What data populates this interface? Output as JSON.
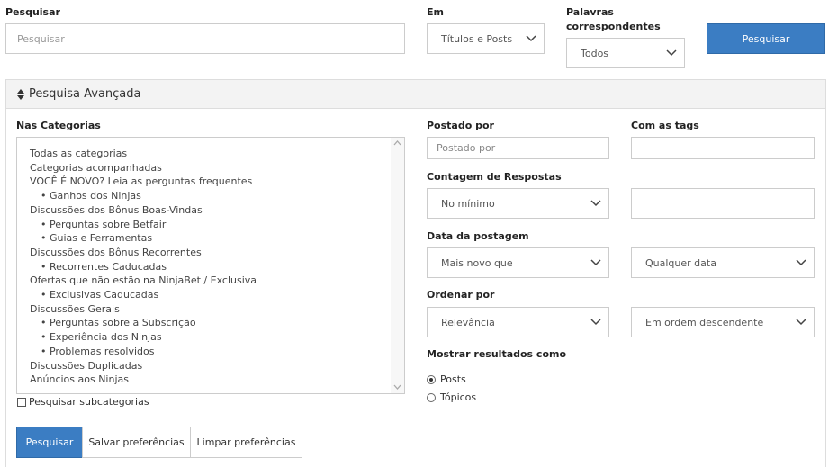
{
  "search": {
    "label": "Pesquisar",
    "placeholder": "Pesquisar",
    "in_label": "Em",
    "in_value": "Títulos e Posts",
    "match_label": "Palavras correspondentes",
    "match_value": "Todos",
    "submit_label": "Pesquisar"
  },
  "advanced": {
    "title": "Pesquisa Avançada",
    "categories_label": "Nas Categorias",
    "categories": [
      {
        "label": "Todas as categorias",
        "level": 0
      },
      {
        "label": "Categorias acompanhadas",
        "level": 0
      },
      {
        "label": "VOCÊ É NOVO? Leia as perguntas frequentes",
        "level": 0
      },
      {
        "label": "• Ganhos dos Ninjas",
        "level": 1
      },
      {
        "label": "Discussões dos Bônus Boas-Vindas",
        "level": 0
      },
      {
        "label": "• Perguntas sobre Betfair",
        "level": 1
      },
      {
        "label": "• Guias e Ferramentas",
        "level": 1
      },
      {
        "label": "Discussões dos Bônus Recorrentes",
        "level": 0
      },
      {
        "label": "• Recorrentes Caducadas",
        "level": 1
      },
      {
        "label": "Ofertas que não estão na NinjaBet / Exclusiva",
        "level": 0
      },
      {
        "label": "• Exclusivas Caducadas",
        "level": 1
      },
      {
        "label": "Discussões Gerais",
        "level": 0
      },
      {
        "label": "• Perguntas sobre a Subscrição",
        "level": 1
      },
      {
        "label": "• Experiência dos Ninjas",
        "level": 1
      },
      {
        "label": "• Problemas resolvidos",
        "level": 1
      },
      {
        "label": "Discussões Duplicadas",
        "level": 0
      },
      {
        "label": "Anúncios aos Ninjas",
        "level": 0
      }
    ],
    "subcategories_label": "Pesquisar subcategorias",
    "posted_by_label": "Postado por",
    "posted_by_placeholder": "Postado por",
    "tags_label": "Com as tags",
    "reply_count_label": "Contagem de Respostas",
    "reply_count_value": "No mínimo",
    "post_date_label": "Data da postagem",
    "post_date_value": "Mais novo que",
    "post_date_range": "Qualquer data",
    "order_label": "Ordenar por",
    "order_value": "Relevância",
    "order_direction": "Em ordem descendente",
    "show_as_label": "Mostrar resultados como",
    "show_as_options": [
      "Posts",
      "Tópicos"
    ]
  },
  "footer": {
    "search": "Pesquisar",
    "save": "Salvar preferências",
    "clear": "Limpar preferências"
  },
  "colors": {
    "primary": "#3b7dc3",
    "panel_header": "#f3f3f3",
    "border": "#cccccc"
  }
}
